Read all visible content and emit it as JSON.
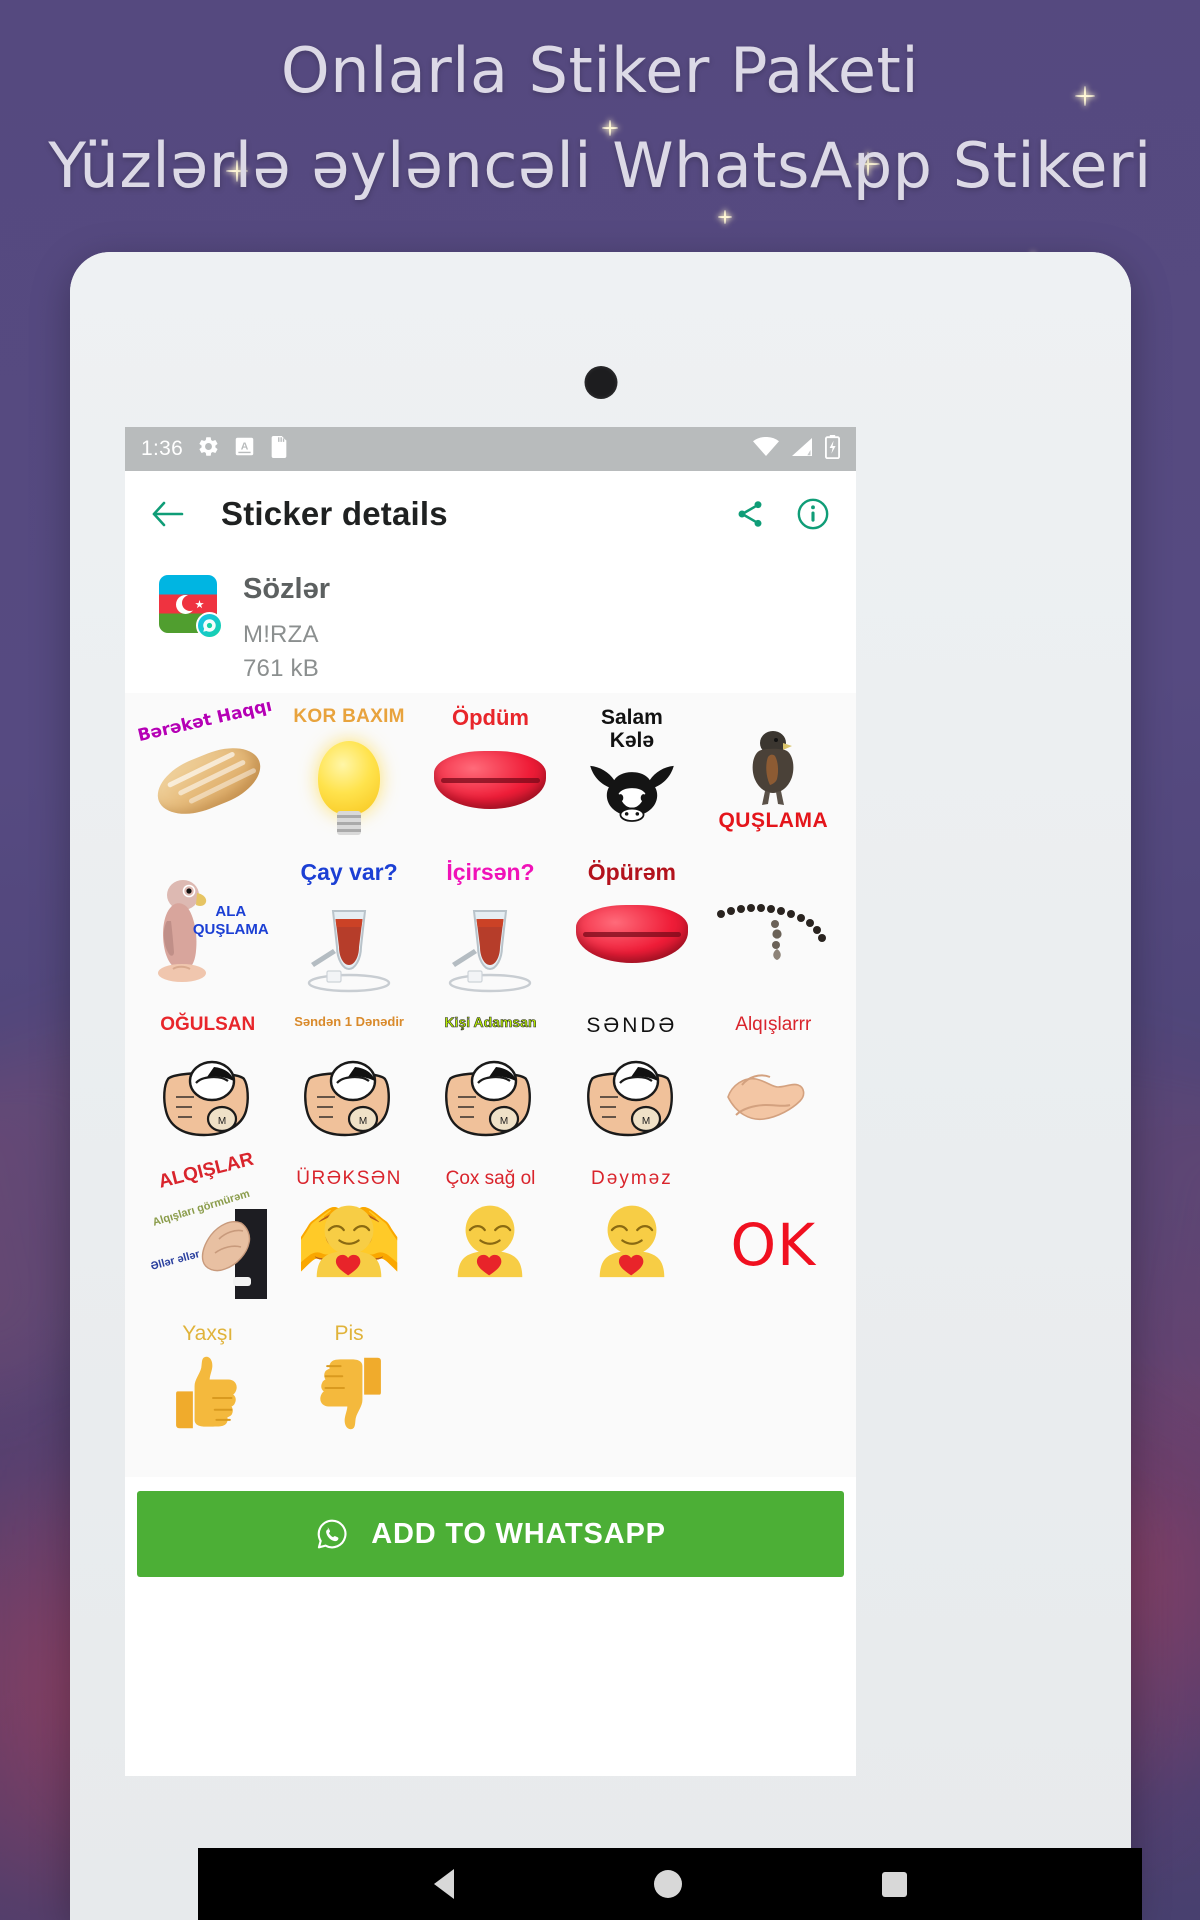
{
  "promo": {
    "line1": "Onlarla Stiker Paketi",
    "line2": "Yüzlərlə əyləncəli WhatsApp Stikeri",
    "bg_color": "#55497f",
    "text_color": "#dcd9e6"
  },
  "status_bar": {
    "time": "1:36",
    "left_icons": [
      "gear-icon",
      "font-size-a-icon",
      "sd-card-icon"
    ],
    "right_icons": [
      "wifi-icon",
      "cellular-signal-icon",
      "battery-charging-icon"
    ],
    "bg_color": "#b8bbbc"
  },
  "appbar": {
    "back_icon": "arrow-left-icon",
    "title": "Sticker details",
    "share_icon": "share-icon",
    "info_icon": "info-icon",
    "accent_color": "#0f9d77"
  },
  "pack": {
    "tray_icon": "azerbaijan-flag-icon",
    "badge_icon": "whatsapp-sticker-badge-icon",
    "name": "Sözlər",
    "author": "M!RZA",
    "size": "761 kB"
  },
  "stickers": [
    {
      "id": 1,
      "caption": "Bərəkət Haqqı",
      "art": "bread"
    },
    {
      "id": 2,
      "caption": "KOR BAXIM",
      "art": "bulb"
    },
    {
      "id": 3,
      "caption": "Öpdüm",
      "art": "lips"
    },
    {
      "id": 4,
      "caption": "Salam Kələ",
      "art": "bull"
    },
    {
      "id": 5,
      "caption": "QUŞLAMA",
      "art": "bird"
    },
    {
      "id": 6,
      "caption": "ALA QUŞLAMA",
      "art": "parrot"
    },
    {
      "id": 7,
      "caption": "Çay var?",
      "art": "tea"
    },
    {
      "id": 8,
      "caption": "İçirsən?",
      "art": "tea"
    },
    {
      "id": 9,
      "caption": "Öpürəm",
      "art": "lips"
    },
    {
      "id": 10,
      "caption": "",
      "art": "beads"
    },
    {
      "id": 11,
      "caption": "OĞULSAN",
      "art": "fist"
    },
    {
      "id": 12,
      "caption": "Səndən 1 Dənədir",
      "art": "fist"
    },
    {
      "id": 13,
      "caption": "Kişi Adamsan",
      "art": "fist"
    },
    {
      "id": 14,
      "caption": "SƏNDƏ",
      "art": "fist"
    },
    {
      "id": 15,
      "caption": "Alqışlarrr",
      "art": "clap"
    },
    {
      "id": 16,
      "caption": "ALQIŞLAR",
      "art": "clap",
      "sub1": "Alqışları görmürəm",
      "sub2": "Əllər əllər əllərrr"
    },
    {
      "id": 17,
      "caption": "ÜRƏKSƏN",
      "art": "hug-emoji"
    },
    {
      "id": 18,
      "caption": "Çox sağ ol",
      "art": "hug-emoji"
    },
    {
      "id": 19,
      "caption": "Dəyməz",
      "art": "hug-emoji"
    },
    {
      "id": 20,
      "caption": "OK",
      "art": "ok-text"
    },
    {
      "id": 21,
      "caption": "Yaxşı",
      "art": "thumbs-up-emoji"
    },
    {
      "id": 22,
      "caption": "Pis",
      "art": "thumbs-down-emoji"
    }
  ],
  "cta": {
    "icon": "whatsapp-icon",
    "label": "ADD TO WHATSAPP",
    "color": "#4caf36"
  },
  "navbar": {
    "back": "triangle-back-icon",
    "home": "circle-home-icon",
    "recents": "square-recents-icon"
  }
}
